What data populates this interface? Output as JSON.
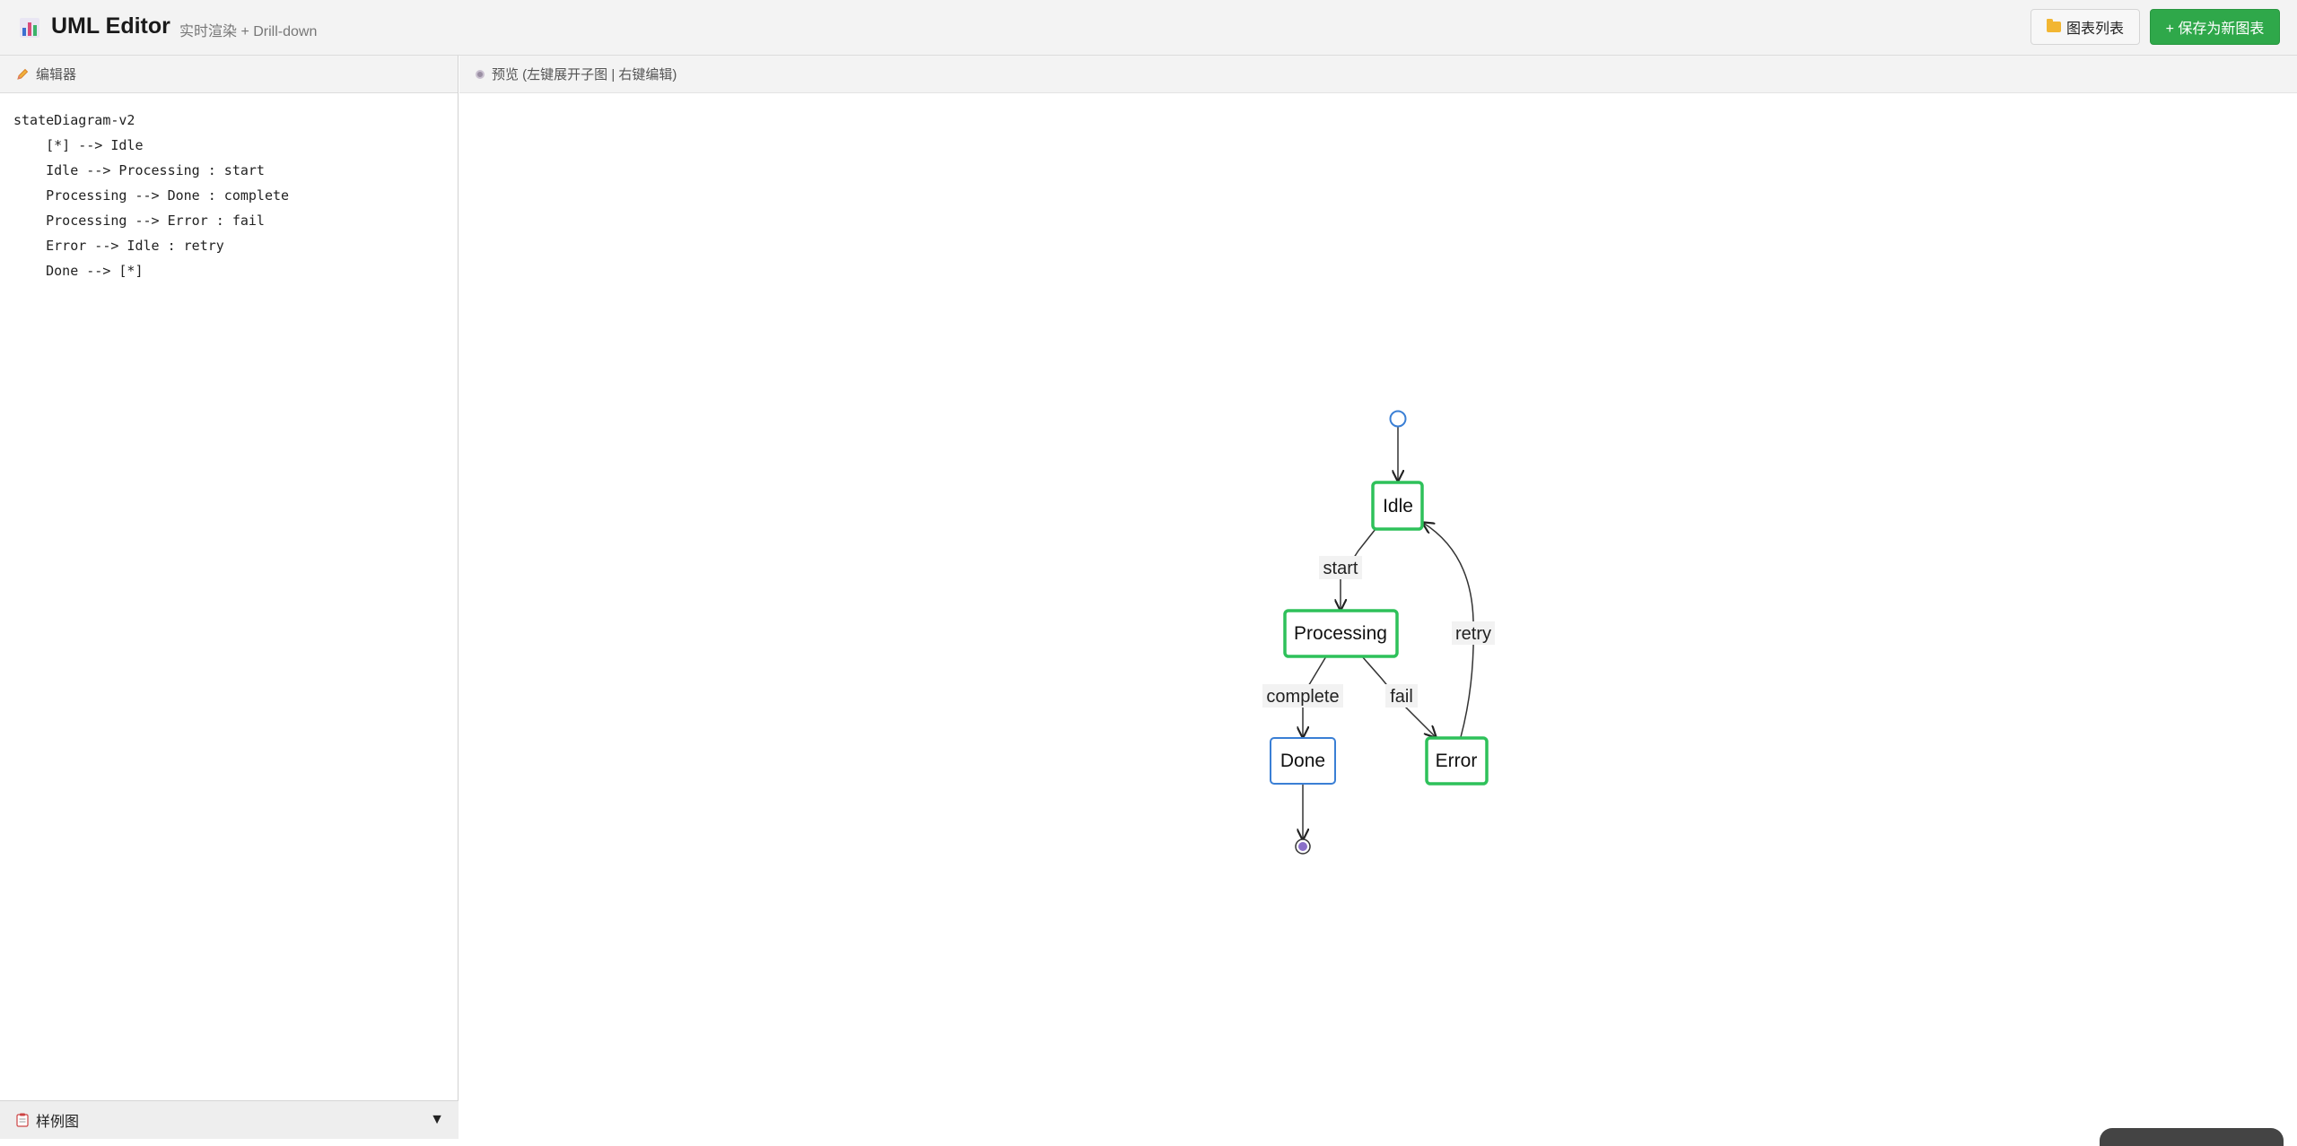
{
  "header": {
    "title": "UML Editor",
    "subtitle": "实时渲染 + Drill-down",
    "list_button": "图表列表",
    "save_button": "+ 保存为新图表"
  },
  "editor": {
    "title": "编辑器",
    "lines": [
      "stateDiagram-v2",
      "    [*] --> Idle",
      "    Idle --> Processing : start",
      "    Processing --> Done : complete",
      "    Processing --> Error : fail",
      "    Error --> Idle : retry",
      "    Done --> [*]"
    ]
  },
  "samples": {
    "label": "样例图",
    "toggle": "▼"
  },
  "preview": {
    "title": "预览 (左键展开子图 | 右键编辑)"
  },
  "diagram": {
    "states": [
      "Idle",
      "Processing",
      "Done",
      "Error"
    ],
    "transitions": [
      "start",
      "complete",
      "fail",
      "retry"
    ],
    "colors": {
      "state_border": "#2ec15a",
      "final_state_border": "#3a7fd5",
      "start_node": "#3a7fd5",
      "end_node": "#8a6fc8"
    }
  },
  "colors": {
    "accent": "#2fa84a",
    "header_bg": "#f3f3f3"
  }
}
